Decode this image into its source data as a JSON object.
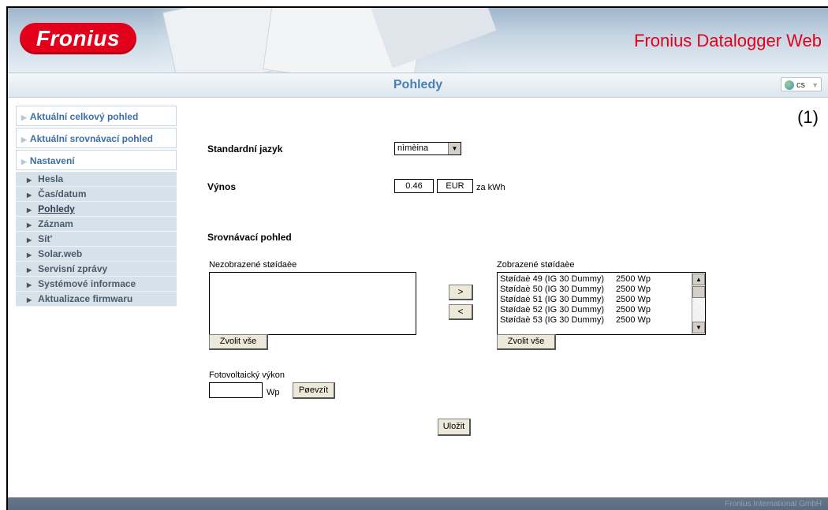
{
  "header": {
    "logo_text": "Fronius",
    "app_title": "Fronius Datalogger Web",
    "brand_color": "#e2001a"
  },
  "titlebar": {
    "page_title": "Pohledy",
    "language": "cs"
  },
  "sidebar": {
    "main_items": [
      {
        "label": "Aktuální celkový pohled"
      },
      {
        "label": "Aktuální srovnávací pohled"
      },
      {
        "label": "Nastavení"
      }
    ],
    "sub_items": [
      {
        "label": "Hesla"
      },
      {
        "label": "Čas/datum"
      },
      {
        "label": "Pohledy",
        "active": true
      },
      {
        "label": "Záznam"
      },
      {
        "label": "Sít'"
      },
      {
        "label": "Solar.web"
      },
      {
        "label": "Servisní zprávy"
      },
      {
        "label": "Systémové informace"
      },
      {
        "label": "Aktualizace firmwaru"
      }
    ]
  },
  "main": {
    "marker": "(1)",
    "standard_language": {
      "label": "Standardní jazyk",
      "value": "nìmèina"
    },
    "yield": {
      "label": "Výnos",
      "value": "0.46",
      "currency": "EUR",
      "unit": "za kWh"
    },
    "comparison": {
      "heading": "Srovnávací pohled",
      "hidden_label": "Nezobrazené støídaèe",
      "shown_label": "Zobrazené støídaèe",
      "select_all": "Zvolit vše",
      "move_right": ">",
      "move_left": "<",
      "shown_items": [
        {
          "name": "Støídaè 49 (IG 30 Dummy)",
          "power": "2500 Wp"
        },
        {
          "name": "Støídaè 50 (IG 30 Dummy)",
          "power": "2500 Wp"
        },
        {
          "name": "Støídaè 51 (IG 30 Dummy)",
          "power": "2500 Wp"
        },
        {
          "name": "Støídaè 52 (IG 30 Dummy)",
          "power": "2500 Wp"
        },
        {
          "name": "Støídaè 53 (IG 30 Dummy)",
          "power": "2500 Wp"
        }
      ]
    },
    "pv_power": {
      "label": "Fotovoltaický výkon",
      "value": "",
      "unit": "Wp",
      "convert_button": "Pøevzít"
    },
    "save_button": "Uložit"
  },
  "footer": {
    "text": "Fronius International GmbH"
  }
}
